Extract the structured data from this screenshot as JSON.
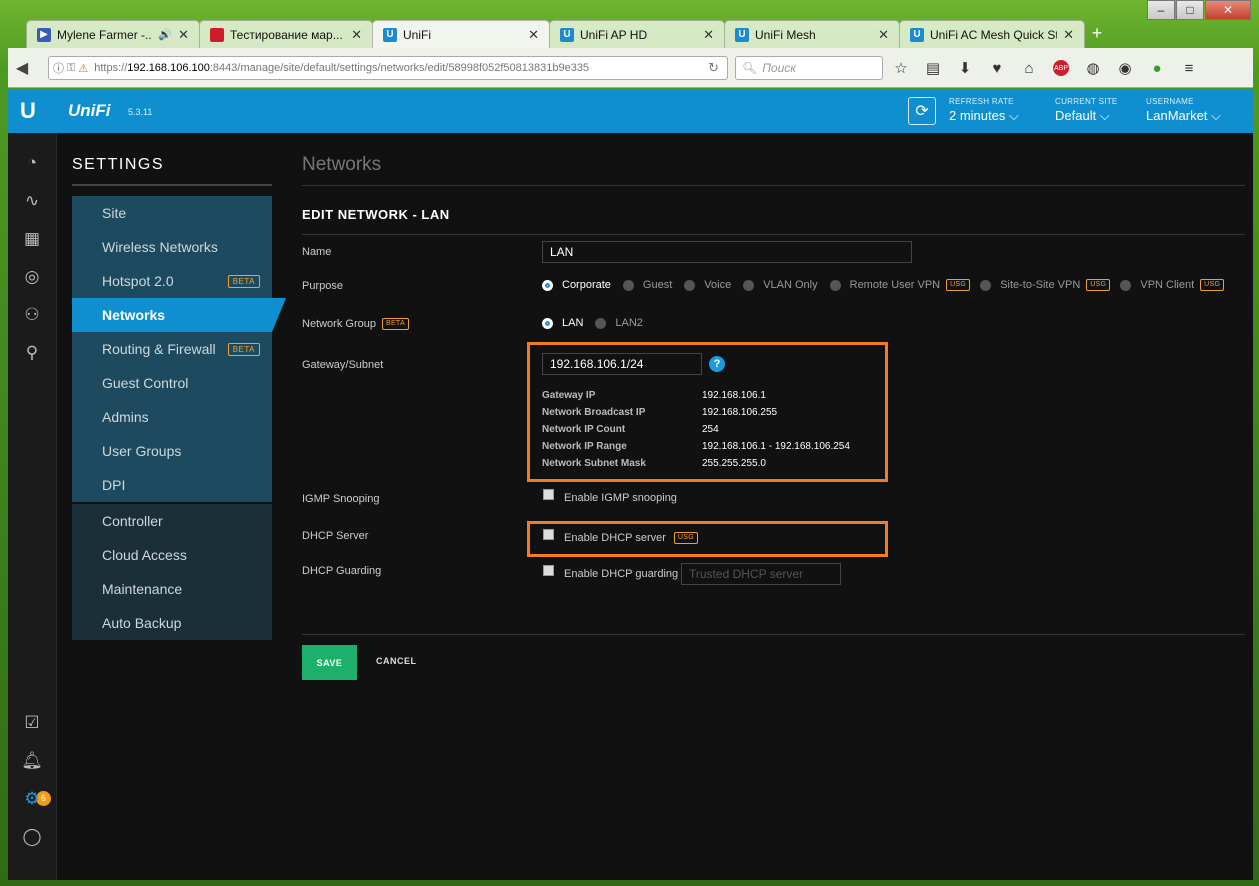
{
  "browser": {
    "tabs": [
      {
        "title": "Mylene Farmer -...",
        "icon": "play-icon",
        "color": "#3a5bb8"
      },
      {
        "title": "Тестирование мар...",
        "icon": "red-cube-icon",
        "color": "#d01c2a"
      },
      {
        "title": "UniFi",
        "icon": "unifi-u-icon",
        "color": "#1a8bd0"
      },
      {
        "title": "UniFi AP HD",
        "icon": "unifi-u-icon",
        "color": "#1a8bd0"
      },
      {
        "title": "UniFi Mesh",
        "icon": "unifi-u-icon",
        "color": "#1a8bd0"
      },
      {
        "title": "UniFi AC Mesh Quick St...",
        "icon": "unifi-u-icon",
        "color": "#1a8bd0"
      }
    ],
    "url_prefix": "https://",
    "url_host": "192.168.106.100",
    "url_rest": ":8443/manage/site/default/settings/networks/edit/58998f052f50813831b9e335",
    "search_placeholder": "Поиск"
  },
  "app": {
    "brand": "UniFi",
    "version": "5.3.11",
    "refresh_rate_label": "REFRESH RATE",
    "refresh_rate_value": "2 minutes ⌵",
    "current_site_label": "CURRENT SITE",
    "current_site_value": "Default ⌵",
    "username_label": "USERNAME",
    "username_value": "LanMarket ⌵",
    "notification_count": "6"
  },
  "sidebar": {
    "title": "SETTINGS",
    "group1": [
      {
        "label": "Site"
      },
      {
        "label": "Wireless Networks"
      },
      {
        "label": "Hotspot 2.0",
        "badge": "BETA"
      },
      {
        "label": "Networks",
        "active": true
      },
      {
        "label": "Routing & Firewall",
        "badge": "BETA"
      },
      {
        "label": "Guest Control"
      },
      {
        "label": "Admins"
      },
      {
        "label": "User Groups"
      },
      {
        "label": "DPI"
      }
    ],
    "group2": [
      {
        "label": "Controller"
      },
      {
        "label": "Cloud Access"
      },
      {
        "label": "Maintenance"
      },
      {
        "label": "Auto Backup"
      }
    ]
  },
  "main": {
    "section_title": "Networks",
    "form_title": "EDIT NETWORK - LAN",
    "name_label": "Name",
    "name_value": "LAN",
    "purpose_label": "Purpose",
    "purpose_options": [
      {
        "label": "Corporate",
        "selected": true
      },
      {
        "label": "Guest"
      },
      {
        "label": "Voice"
      },
      {
        "label": "VLAN Only"
      },
      {
        "label": "Remote User VPN",
        "usg": "USG"
      },
      {
        "label": "Site-to-Site VPN",
        "usg": "USG"
      },
      {
        "label": "VPN Client",
        "usg": "USG"
      }
    ],
    "network_group_label": "Network Group",
    "network_group_badge": "BETA",
    "network_group_options": [
      {
        "label": "LAN",
        "selected": true
      },
      {
        "label": "LAN2"
      }
    ],
    "gateway_label": "Gateway/Subnet",
    "gateway_value": "192.168.106.1/24",
    "help_icon": "?",
    "subnet_info": [
      {
        "key": "Gateway IP",
        "value": "192.168.106.1"
      },
      {
        "key": "Network Broadcast IP",
        "value": "192.168.106.255"
      },
      {
        "key": "Network IP Count",
        "value": "254"
      },
      {
        "key": "Network IP Range",
        "value": "192.168.106.1 - 192.168.106.254"
      },
      {
        "key": "Network Subnet Mask",
        "value": "255.255.255.0"
      }
    ],
    "igmp_label": "IGMP Snooping",
    "igmp_text": "Enable IGMP snooping",
    "dhcp_server_label": "DHCP Server",
    "dhcp_server_text": "Enable DHCP server",
    "dhcp_server_badge": "USG",
    "dhcp_guarding_label": "DHCP Guarding",
    "dhcp_guarding_text": "Enable DHCP guarding",
    "trusted_dhcp_placeholder": "Trusted DHCP server",
    "save_label": "SAVE",
    "cancel_label": "CANCEL"
  },
  "colors": {
    "accent": "#0f8fd0",
    "save": "#1cb06a",
    "highlight_box": "#f07d22",
    "beta": "#f0a030"
  }
}
